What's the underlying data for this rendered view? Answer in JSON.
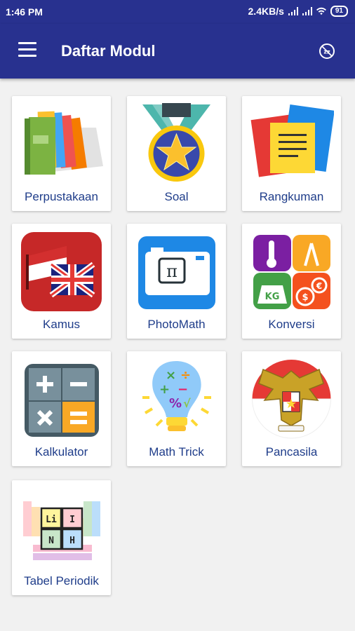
{
  "status_bar": {
    "time": "1:46 PM",
    "speed": "2.4KB/s",
    "battery": "91"
  },
  "app_bar": {
    "title": "Daftar Modul",
    "menu_icon": "hamburger-menu-icon",
    "action_icon": "zzz-badge-icon"
  },
  "modules": [
    {
      "label": "Perpustakaan",
      "icon": "books-icon"
    },
    {
      "label": "Soal",
      "icon": "medal-star-icon"
    },
    {
      "label": "Rangkuman",
      "icon": "notes-icon"
    },
    {
      "label": "Kamus",
      "icon": "flags-icon"
    },
    {
      "label": "PhotoMath",
      "icon": "camera-pi-icon"
    },
    {
      "label": "Konversi",
      "icon": "conversion-icon"
    },
    {
      "label": "Kalkulator",
      "icon": "calculator-icon"
    },
    {
      "label": "Math Trick",
      "icon": "lightbulb-math-icon"
    },
    {
      "label": "Pancasila",
      "icon": "garuda-icon"
    },
    {
      "label": "Tabel Periodik",
      "icon": "periodic-table-icon"
    }
  ],
  "colors": {
    "primary": "#28318f",
    "label_text": "#1f3d8a",
    "background": "#f1f1f1"
  }
}
